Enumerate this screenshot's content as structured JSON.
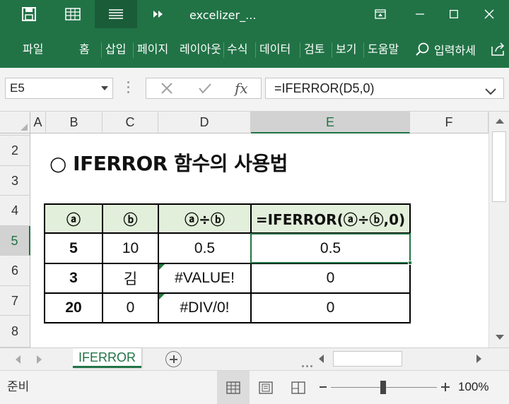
{
  "title_bar": {
    "title": "excelizer_...",
    "icons": [
      "save-icon",
      "table-icon",
      "menu-lines-icon",
      "more-icon"
    ],
    "window_buttons": [
      "restore-ribbon-icon",
      "minimize-icon",
      "maximize-icon",
      "close-icon"
    ]
  },
  "ribbon": {
    "tabs": [
      {
        "id": "file",
        "label": "파일"
      },
      {
        "id": "home",
        "label": "홈"
      },
      {
        "id": "insert",
        "label": "삽입"
      },
      {
        "id": "page-layout",
        "label": "페이지"
      },
      {
        "id": "layout",
        "label": "레이아웃"
      },
      {
        "id": "formulas",
        "label": "수식"
      },
      {
        "id": "data",
        "label": "데이터"
      },
      {
        "id": "review",
        "label": "검토"
      },
      {
        "id": "view",
        "label": "보기"
      },
      {
        "id": "help",
        "label": "도움말"
      }
    ],
    "search_label": "입력하세",
    "search_icon": "search-icon",
    "share_icon": "share-icon"
  },
  "formula_bar": {
    "name_box": "E5",
    "fx_label": "fx",
    "formula": "=IFERROR(D5,0)"
  },
  "grid": {
    "columns": [
      "A",
      "B",
      "C",
      "D",
      "E",
      "F"
    ],
    "selected_column": "E",
    "rows": [
      "2",
      "3",
      "4",
      "5",
      "6",
      "7",
      "8"
    ],
    "selected_row": "5",
    "heading": "○ IFERROR 함수의 사용법",
    "table": {
      "headers": [
        "ⓐ",
        "ⓑ",
        "ⓐ÷ⓑ",
        "=IFERROR(ⓐ÷ⓑ,0)"
      ],
      "rows": [
        [
          "5",
          "10",
          "0.5",
          "0.5"
        ],
        [
          "3",
          "김",
          "#VALUE!",
          "0"
        ],
        [
          "20",
          "0",
          "#DIV/0!",
          "0"
        ]
      ]
    },
    "accent_color": "#217346",
    "header_fill": "#e2efda"
  },
  "sheet_tabs": {
    "tabs": [
      "IFERROR"
    ],
    "active": "IFERROR"
  },
  "status_bar": {
    "status": "준비",
    "zoom": "100%"
  }
}
